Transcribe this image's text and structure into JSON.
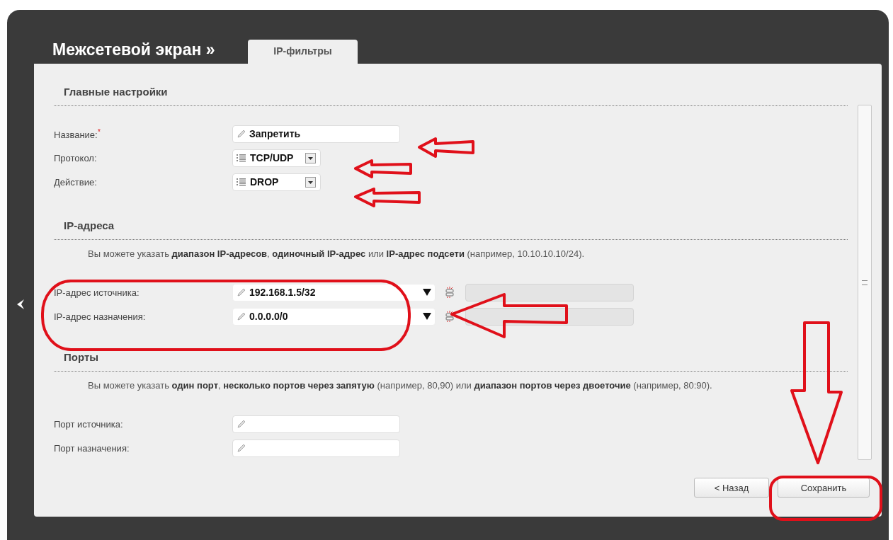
{
  "header": {
    "title": "Межсетевой экран »",
    "tabs": [
      {
        "label": "IP-фильтры",
        "selected": true
      }
    ]
  },
  "sections": [
    {
      "title": "Главные настройки",
      "fields": [
        {
          "kind": "text",
          "label": "Название:",
          "required_mark": "*",
          "value": "Запретить"
        },
        {
          "kind": "select",
          "label": "Протокол:",
          "value": "TCP/UDP"
        },
        {
          "kind": "select",
          "label": "Действие:",
          "value": "DROP"
        }
      ]
    },
    {
      "title": "IP-адреса",
      "note": "Вы можете указать **диапазон IP-адресов**, **одиночный IP-адрес** или **IP-адрес подсети** (например, 10.10.10.10/24).",
      "fields": [
        {
          "kind": "combo",
          "label": "IP-адрес источника:",
          "value": "192.168.1.5/32"
        },
        {
          "kind": "combo",
          "label": "IP-адрес назначения:",
          "value": "0.0.0.0/0"
        }
      ]
    },
    {
      "title": "Порты",
      "note": "Вы можете указать **один порт**, **несколько портов через запятую** (например, 80,90) или **диапазон портов через двоеточие** (например, 80:90).",
      "fields": [
        {
          "kind": "text",
          "label": "Порт источника:"
        },
        {
          "kind": "text",
          "label": "Порт назначения:"
        }
      ]
    }
  ],
  "buttons": [
    {
      "label": "< Назад",
      "kind": "secondary"
    },
    {
      "label": "Сохранить",
      "kind": "primary"
    }
  ]
}
